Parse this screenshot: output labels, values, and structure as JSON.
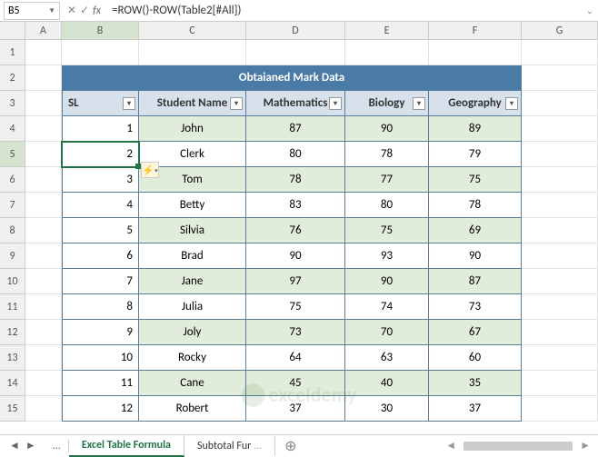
{
  "name_box": "B5",
  "formula": "=ROW()-ROW(Table2[#All])",
  "col_headers": [
    "A",
    "B",
    "C",
    "D",
    "E",
    "F",
    "G"
  ],
  "row_headers": [
    "1",
    "2",
    "3",
    "4",
    "5",
    "6",
    "7",
    "8",
    "9",
    "10",
    "11",
    "12",
    "13",
    "14",
    "15"
  ],
  "table": {
    "title": "Obtaianed Mark Data",
    "headers": {
      "sl": "SL",
      "name": "Student Name",
      "math": "Mathematics",
      "bio": "Biology",
      "geo": "Geography"
    },
    "rows": [
      {
        "sl": "1",
        "name": "John",
        "math": "87",
        "bio": "90",
        "geo": "89"
      },
      {
        "sl": "2",
        "name": "Clerk",
        "math": "80",
        "bio": "78",
        "geo": "79"
      },
      {
        "sl": "3",
        "name": "Tom",
        "math": "78",
        "bio": "77",
        "geo": "75"
      },
      {
        "sl": "4",
        "name": "Betty",
        "math": "83",
        "bio": "80",
        "geo": "78"
      },
      {
        "sl": "5",
        "name": "Silvia",
        "math": "76",
        "bio": "75",
        "geo": "69"
      },
      {
        "sl": "6",
        "name": "Brad",
        "math": "90",
        "bio": "93",
        "geo": "90"
      },
      {
        "sl": "7",
        "name": "Jane",
        "math": "97",
        "bio": "90",
        "geo": "87"
      },
      {
        "sl": "8",
        "name": "Julia",
        "math": "75",
        "bio": "74",
        "geo": "73"
      },
      {
        "sl": "9",
        "name": "Joly",
        "math": "73",
        "bio": "70",
        "geo": "67"
      },
      {
        "sl": "10",
        "name": "Rocky",
        "math": "64",
        "bio": "63",
        "geo": "60"
      },
      {
        "sl": "11",
        "name": "Cane",
        "math": "45",
        "bio": "40",
        "geo": "35"
      },
      {
        "sl": "12",
        "name": "Robert",
        "math": "37",
        "bio": "30",
        "geo": "37"
      }
    ]
  },
  "tabs": {
    "more": "...",
    "active": "Excel Table Formula",
    "next": "Subtotal Fur",
    "add": "⊕"
  },
  "watermark": "exceldemy"
}
